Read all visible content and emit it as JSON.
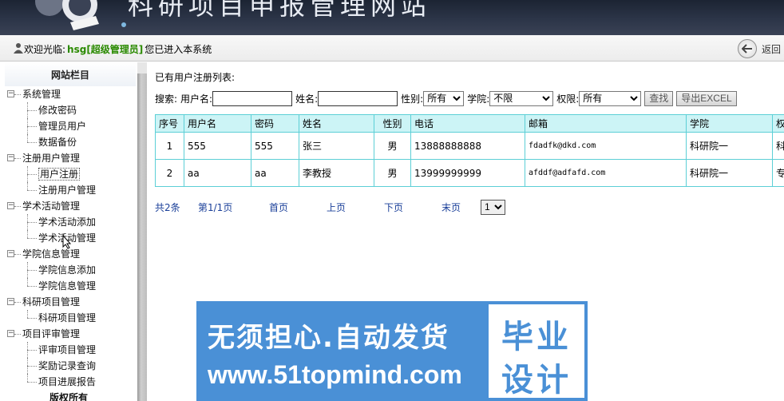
{
  "header": {
    "title": "科研项目申报管理网站"
  },
  "welcome": {
    "prefix": "欢迎光临:",
    "username": "hsg[超级管理员]",
    "suffix": "您已进入本系统",
    "back_label": "返回"
  },
  "sidebar": {
    "title": "网站栏目",
    "groups": [
      {
        "label": "系统管理",
        "items": [
          "修改密码",
          "管理员用户",
          "数据备份"
        ]
      },
      {
        "label": "注册用户管理",
        "items": [
          "用户注册",
          "注册用户管理"
        ]
      },
      {
        "label": "学术活动管理",
        "items": [
          "学术活动添加",
          "学术活动管理"
        ]
      },
      {
        "label": "学院信息管理",
        "items": [
          "学院信息添加",
          "学院信息管理"
        ]
      },
      {
        "label": "科研项目管理",
        "items": [
          "科研项目管理"
        ]
      },
      {
        "label": "项目评审管理",
        "items": [
          "评审项目管理",
          "奖励记录查询",
          "项目进展报告"
        ]
      }
    ],
    "bottom_label": "版权所有"
  },
  "main": {
    "list_title": "已有用户注册列表:",
    "search": {
      "label": "搜索:",
      "username_label": "用户名:",
      "username_value": "",
      "name_label": "姓名:",
      "name_value": "",
      "gender_label": "性别:",
      "gender_value": "所有",
      "college_label": "学院:",
      "college_value": "不限",
      "permission_label": "权限:",
      "permission_value": "所有",
      "search_button": "查找",
      "export_button": "导出EXCEL"
    },
    "table": {
      "headers": [
        "序号",
        "用户名",
        "密码",
        "姓名",
        "性别",
        "电话",
        "邮箱",
        "学院",
        "权限"
      ],
      "rows": [
        [
          "1",
          "555",
          "555",
          "张三",
          "男",
          "13888888888",
          "fdadfk@dkd.com",
          "科研院一",
          "科研"
        ],
        [
          "2",
          "aa",
          "aa",
          "李教授",
          "男",
          "13999999999",
          "afddf@adfafd.com",
          "科研院一",
          "专家"
        ]
      ]
    },
    "pager": {
      "total": "共2条",
      "page_info": "第1/1页",
      "first": "首页",
      "prev": "上页",
      "next": "下页",
      "last": "末页",
      "page_select": "1"
    }
  },
  "watermark": {
    "line1": "无须担心.自动发货",
    "line2": "www.51topmind.com",
    "stamp_line1": "毕业",
    "stamp_line2": "设计"
  },
  "colors": {
    "table_border": "#5ccfd6",
    "table_header_bg": "#ccf4f6",
    "link": "#1a3f99",
    "username": "#2a8a00",
    "watermark_bg": "#4a90d6"
  }
}
